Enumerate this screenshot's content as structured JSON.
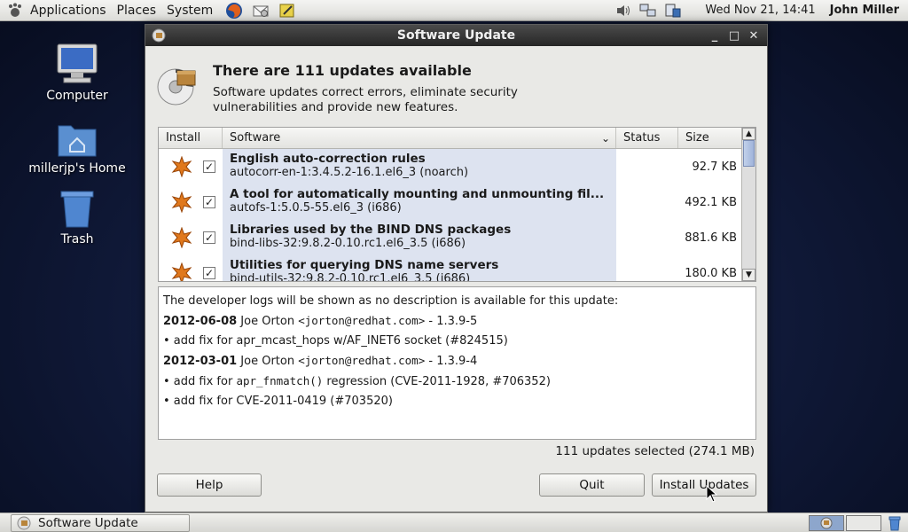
{
  "top_panel": {
    "menus": [
      "Applications",
      "Places",
      "System"
    ],
    "clock": "Wed Nov 21, 14:41",
    "user": "John Miller"
  },
  "desktop": {
    "icons": [
      {
        "label": "Computer",
        "icon": "computer-icon"
      },
      {
        "label": "millerjp's Home",
        "icon": "home-folder-icon"
      },
      {
        "label": "Trash",
        "icon": "trash-icon"
      }
    ]
  },
  "window": {
    "title": "Software Update",
    "heading": "There are 111 updates available",
    "description": "Software updates correct errors, eliminate security vulnerabilities and provide new features.",
    "columns": {
      "install": "Install",
      "software": "Software",
      "status": "Status",
      "size": "Size"
    },
    "packages": [
      {
        "title": "English auto-correction rules",
        "id": "autocorr-en-1:3.4.5.2-16.1.el6_3 (noarch)",
        "size": "92.7 KB",
        "checked": true
      },
      {
        "title": "A tool for automatically mounting and unmounting fil...",
        "id": "autofs-1:5.0.5-55.el6_3 (i686)",
        "size": "492.1 KB",
        "checked": true
      },
      {
        "title": "Libraries used by the BIND DNS packages",
        "id": "bind-libs-32:9.8.2-0.10.rc1.el6_3.5 (i686)",
        "size": "881.6 KB",
        "checked": true
      },
      {
        "title": "Utilities for querying DNS name servers",
        "id": "bind-utils-32:9.8.2-0.10.rc1.el6_3.5 (i686)",
        "size": "180.0 KB",
        "checked": true
      }
    ],
    "details": {
      "intro": "The developer logs will be shown as no description is available for this update:",
      "entries": [
        {
          "date": "2012-06-08",
          "author": "Joe Orton",
          "email": "<jorton@redhat.com>",
          "version": "- 1.3.9-5"
        },
        {
          "bullet": "• add fix for apr_mcast_hops w/AF_INET6 socket (#824515)"
        },
        {
          "date": "2012-03-01",
          "author": "Joe Orton",
          "email": "<jorton@redhat.com>",
          "version": "- 1.3.9-4"
        },
        {
          "bullet_pre": "• add fix for ",
          "bullet_code": "apr_fnmatch()",
          "bullet_post": " regression (CVE-2011-1928, #706352)"
        },
        {
          "bullet": "• add fix for CVE-2011-0419 (#703520)"
        }
      ]
    },
    "summary": "111 updates selected (274.1 MB)",
    "buttons": {
      "help": "Help",
      "quit": "Quit",
      "install": "Install Updates"
    }
  },
  "bottom_panel": {
    "task": "Software Update"
  }
}
